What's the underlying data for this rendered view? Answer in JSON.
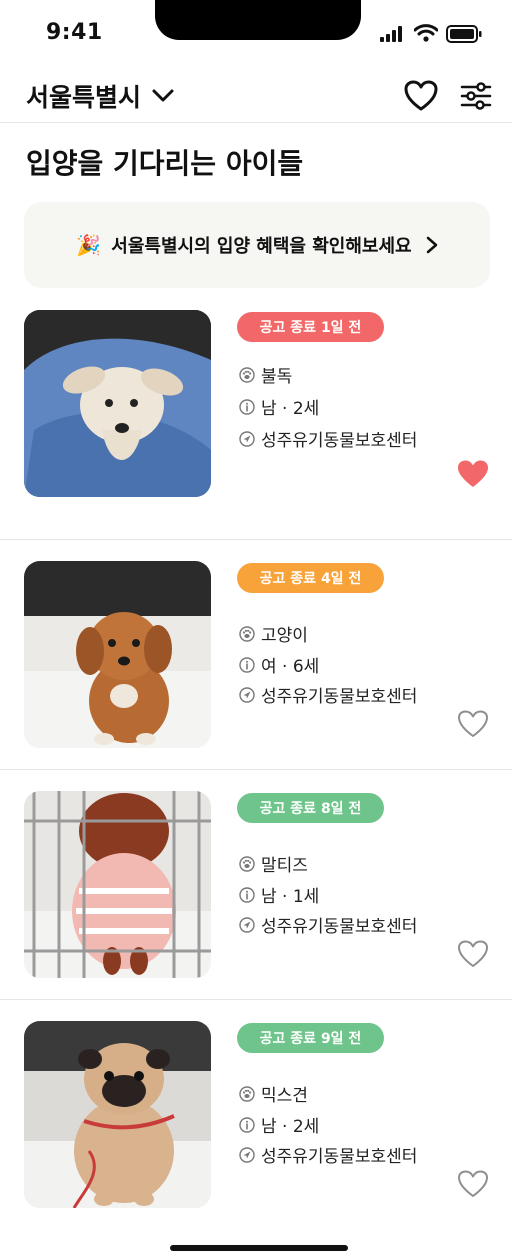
{
  "status_bar": {
    "time": "9:41"
  },
  "header": {
    "region": "서울특별시"
  },
  "page_title": "입양을 기다리는 아이들",
  "banner": {
    "emoji": "🎉",
    "text": "서울특별시의 입양 혜택을 확인해보세요"
  },
  "colors": {
    "red": "#f26868",
    "orange": "#f8a23a",
    "green": "#6ec48a",
    "fav_filled": "#f26868",
    "fav_outline": "#8e8e8e"
  },
  "items": [
    {
      "badge": "공고 종료 1일 전",
      "badge_color": "red",
      "breed": "불독",
      "info": "남 · 2세",
      "center": "성주유기동물보호센터",
      "favorite": true
    },
    {
      "badge": "공고 종료 4일 전",
      "badge_color": "orange",
      "breed": "고양이",
      "info": "여 · 6세",
      "center": "성주유기동물보호센터",
      "favorite": false
    },
    {
      "badge": "공고 종료 8일 전",
      "badge_color": "green",
      "breed": "말티즈",
      "info": "남 · 1세",
      "center": "성주유기동물보호센터",
      "favorite": false
    },
    {
      "badge": "공고 종료 9일 전",
      "badge_color": "green",
      "breed": "믹스견",
      "info": "남 · 2세",
      "center": "성주유기동물보호센터",
      "favorite": false
    }
  ]
}
